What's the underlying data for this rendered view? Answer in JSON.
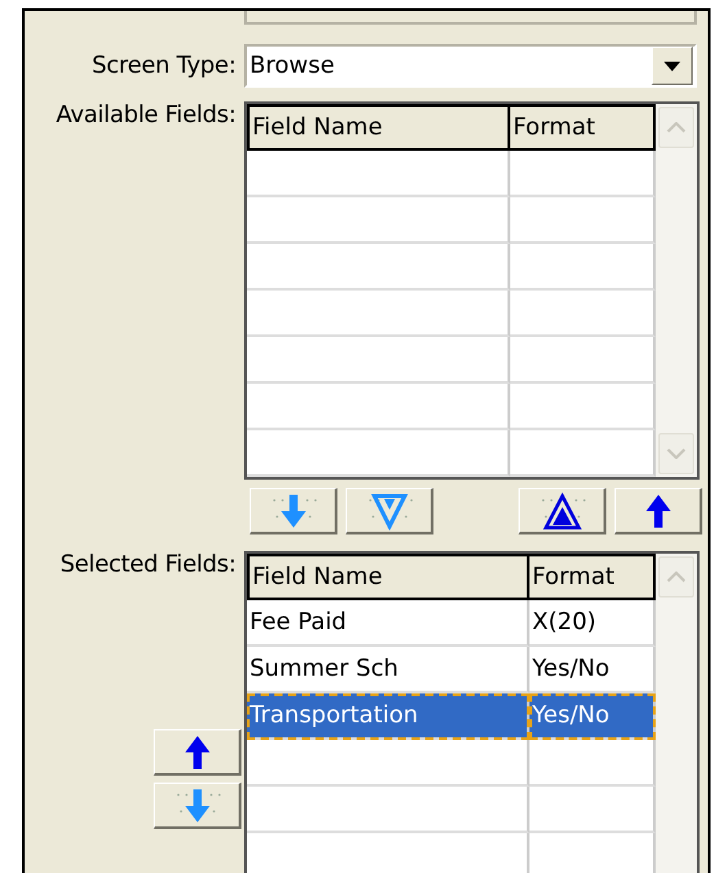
{
  "screen_type": {
    "label": "Screen Type:",
    "value": "Browse"
  },
  "available_fields": {
    "label": "Available Fields:",
    "columns": [
      "Field Name",
      "Format"
    ]
  },
  "transfer_buttons": [
    {
      "kind": "down"
    },
    {
      "kind": "all-down"
    },
    {
      "kind": "all-up"
    },
    {
      "kind": "up"
    }
  ],
  "selected_fields": {
    "label": "Selected Fields:",
    "columns": [
      "Field Name",
      "Format"
    ],
    "rows": [
      {
        "field_name": "Fee Paid",
        "format": "X(20)",
        "selected": false
      },
      {
        "field_name": "Summer Sch",
        "format": "Yes/No",
        "selected": false
      },
      {
        "field_name": "Transportation",
        "format": "Yes/No",
        "selected": true
      }
    ]
  },
  "order_buttons": [
    {
      "kind": "up"
    },
    {
      "kind": "down"
    }
  ]
}
